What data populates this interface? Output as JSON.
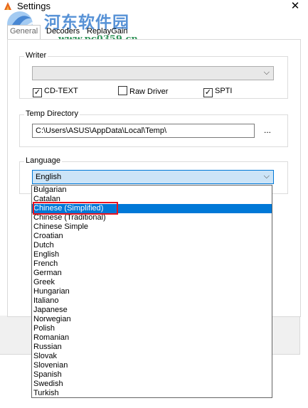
{
  "window": {
    "title": "Settings",
    "close_label": "✕"
  },
  "watermark": {
    "title": "河东软件园",
    "url": "www.pc0359.cn"
  },
  "tabs": [
    {
      "label": "General",
      "active": true
    },
    {
      "label": "Decoders",
      "active": false
    },
    {
      "label": "ReplayGain",
      "active": false
    }
  ],
  "writer": {
    "group_label": "Writer",
    "selected": "",
    "cd_text": {
      "label": "CD-TEXT",
      "checked": true
    },
    "raw_driver": {
      "label": "Raw Driver",
      "checked": false
    },
    "spti": {
      "label": "SPTI",
      "checked": true
    }
  },
  "temp_directory": {
    "group_label": "Temp Directory",
    "value": "C:\\Users\\ASUS\\AppData\\Local\\Temp\\",
    "browse_label": "..."
  },
  "language": {
    "group_label": "Language",
    "selected": "English",
    "options": [
      "Bulgarian",
      "Catalan",
      "Chinese (Simplified)",
      "Chinese (Traditional)",
      "Chinese Simple",
      "Croatian",
      "Dutch",
      "English",
      "French",
      "German",
      "Greek",
      "Hungarian",
      "Italiano",
      "Japanese",
      "Norwegian",
      "Polish",
      "Romanian",
      "Russian",
      "Slovak",
      "Slovenian",
      "Spanish",
      "Swedish",
      "Turkish"
    ],
    "highlighted": "Chinese (Simplified)"
  },
  "colors": {
    "selection": "#0078d7",
    "annotation": "#e8121e",
    "watermark_blue": "#3a7fd0",
    "watermark_green": "#1e8a4a"
  }
}
